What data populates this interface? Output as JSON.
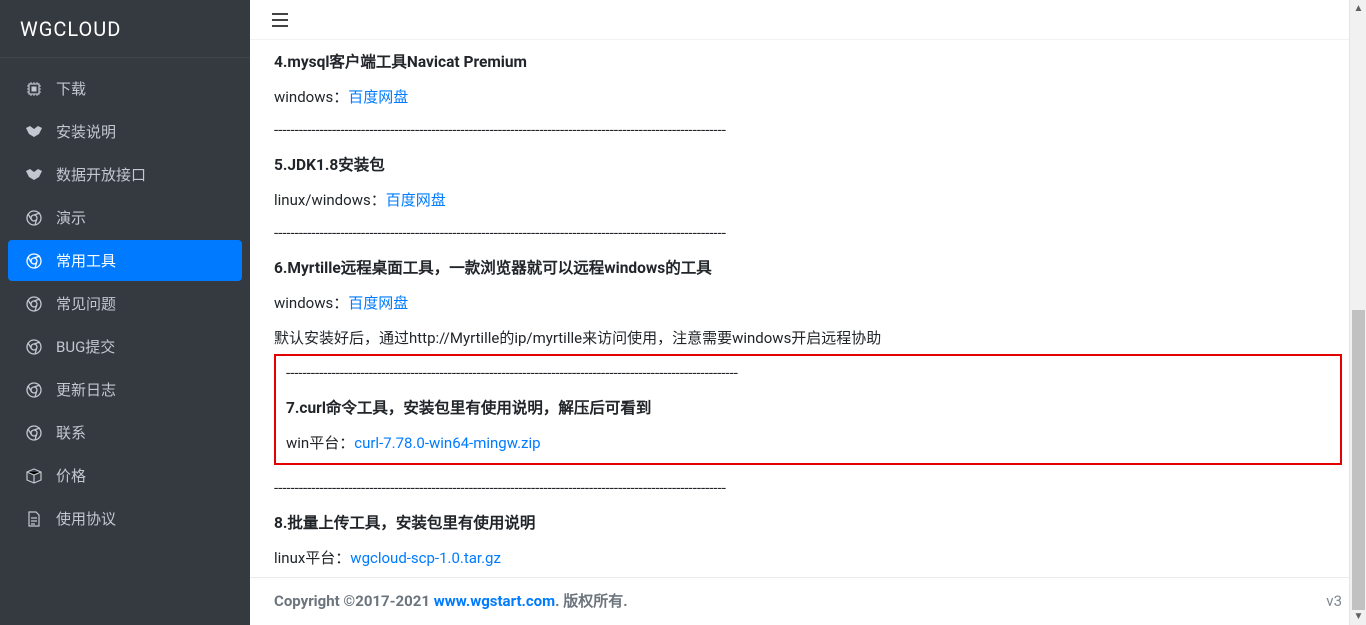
{
  "brand": "WGCLOUD",
  "sidebar": {
    "items": [
      {
        "label": "下载",
        "icon": "chip-icon"
      },
      {
        "label": "安装说明",
        "icon": "handshake-icon"
      },
      {
        "label": "数据开放接口",
        "icon": "handshake-icon"
      },
      {
        "label": "演示",
        "icon": "chrome-icon"
      },
      {
        "label": "常用工具",
        "icon": "chrome-icon"
      },
      {
        "label": "常见问题",
        "icon": "chrome-icon"
      },
      {
        "label": "BUG提交",
        "icon": "chrome-icon"
      },
      {
        "label": "更新日志",
        "icon": "chrome-icon"
      },
      {
        "label": "联系",
        "icon": "chrome-icon"
      },
      {
        "label": "价格",
        "icon": "box-icon"
      },
      {
        "label": "使用协议",
        "icon": "file-icon"
      }
    ],
    "active_index": 4
  },
  "content": {
    "divider": "-------------------------------------------------------------------------------------------------------------",
    "sections": [
      {
        "title": "4.mysql客户端工具Navicat Premium",
        "lines": [
          {
            "prefix": "windows：",
            "link_text": "百度网盘"
          }
        ]
      },
      {
        "title": "5.JDK1.8安装包",
        "lines": [
          {
            "prefix": "linux/windows：",
            "link_text": "百度网盘"
          }
        ]
      },
      {
        "title": "6.Myrtille远程桌面工具，一款浏览器就可以远程windows的工具",
        "lines": [
          {
            "prefix": "windows：",
            "link_text": "百度网盘"
          },
          {
            "text": "默认安装好后，通过http://Myrtille的ip/myrtille来访问使用，注意需要windows开启远程协助"
          }
        ]
      },
      {
        "title": "7.curl命令工具，安装包里有使用说明，解压后可看到",
        "highlighted": true,
        "lines": [
          {
            "prefix": "win平台：",
            "link_text": "curl-7.78.0-win64-mingw.zip"
          }
        ]
      },
      {
        "title": "8.批量上传工具，安装包里有使用说明",
        "lines": [
          {
            "prefix": "linux平台：",
            "link_text": "wgcloud-scp-1.0.tar.gz"
          }
        ]
      }
    ]
  },
  "footer": {
    "copyright_prefix": "Copyright ©2017-2021 ",
    "site_link": "www.wgstart.com",
    "copyright_suffix": ". 版权所有.",
    "version": "v3"
  }
}
